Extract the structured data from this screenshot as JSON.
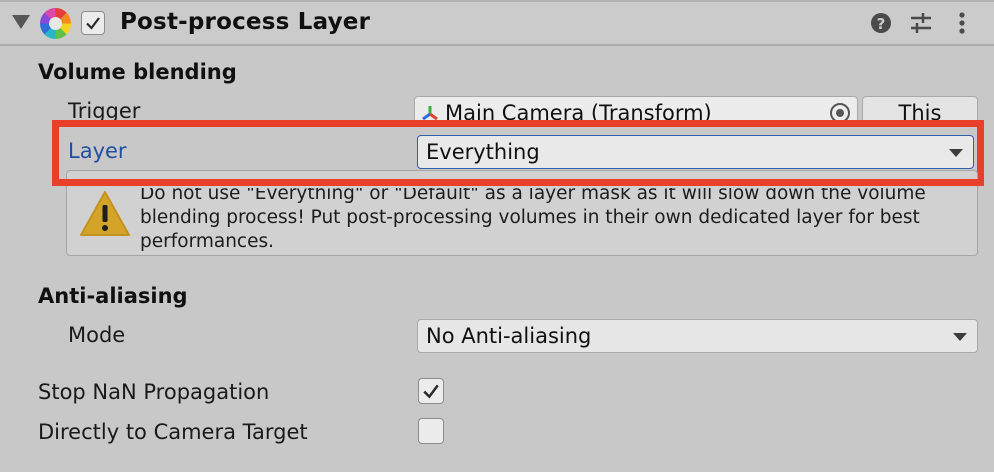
{
  "header": {
    "title": "Post-process Layer",
    "enabled_checked": true,
    "icons": [
      "foldout-triangle-icon",
      "post-process-icon",
      "help-icon",
      "preset-icon",
      "more-icon"
    ]
  },
  "volume_blending": {
    "section_label": "Volume blending",
    "trigger_label": "Trigger",
    "trigger_value": "Main Camera (Transform)",
    "this_button": "This",
    "layer_label": "Layer",
    "layer_value": "Everything",
    "warning": "Do not use \"Everything\" or \"Default\" as a layer mask as it will slow down the volume blending process! Put post-processing volumes in their own dedicated layer for best performances."
  },
  "anti_aliasing": {
    "section_label": "Anti-aliasing",
    "mode_label": "Mode",
    "mode_value": "No Anti-aliasing"
  },
  "options": {
    "stop_nan_label": "Stop NaN Propagation",
    "stop_nan_checked": true,
    "direct_target_label": "Directly to Camera Target",
    "direct_target_checked": false
  },
  "colors": {
    "highlight": "#e8402a",
    "layer_label": "#1f4fa3",
    "warning_icon": "#d4a42a"
  }
}
